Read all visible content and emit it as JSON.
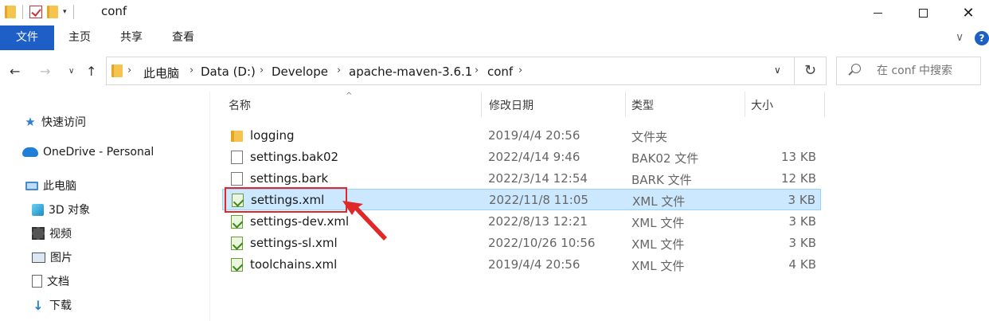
{
  "window": {
    "title": "conf",
    "controls": {
      "minimize": "—",
      "maximize": "☐",
      "close": "✕"
    }
  },
  "quick_access_toolbar": {
    "dropdown_glyph": "▾"
  },
  "ribbon": {
    "tabs": [
      "文件",
      "主页",
      "共享",
      "查看"
    ],
    "expand_glyph": "∨",
    "help_glyph": "?"
  },
  "navigation": {
    "back": "←",
    "forward": "→",
    "recent": "∨",
    "up": "↑",
    "refresh": "↻",
    "breadcrumb": [
      "此电脑",
      "Data (D:)",
      "Develope",
      "apache-maven-3.6.1",
      "conf"
    ],
    "separator": "›",
    "dropdown": "∨"
  },
  "search": {
    "placeholder": "在 conf 中搜索"
  },
  "nav_pane": {
    "items": [
      {
        "label": "快速访问",
        "icon": "star-icon"
      },
      {
        "label": "OneDrive - Personal",
        "icon": "cloud-icon"
      },
      {
        "label": "此电脑",
        "icon": "computer-icon"
      },
      {
        "label": "3D 对象",
        "icon": "cube-icon"
      },
      {
        "label": "视频",
        "icon": "video-icon"
      },
      {
        "label": "图片",
        "icon": "picture-icon"
      },
      {
        "label": "文档",
        "icon": "document-icon"
      },
      {
        "label": "下载",
        "icon": "download-icon"
      }
    ]
  },
  "file_list": {
    "columns": [
      "名称",
      "修改日期",
      "类型",
      "大小"
    ],
    "sort_indicator": "^",
    "rows": [
      {
        "name": "logging",
        "date": "2019/4/4 20:56",
        "type": "文件夹",
        "size": "",
        "icon": "folder-icon"
      },
      {
        "name": "settings.bak02",
        "date": "2022/4/14 9:46",
        "type": "BAK02 文件",
        "size": "13 KB",
        "icon": "file-icon"
      },
      {
        "name": "settings.bark",
        "date": "2022/3/14 12:54",
        "type": "BARK 文件",
        "size": "12 KB",
        "icon": "file-icon"
      },
      {
        "name": "settings.xml",
        "date": "2022/11/8 11:05",
        "type": "XML 文件",
        "size": "3 KB",
        "icon": "xml-file-icon",
        "selected": true
      },
      {
        "name": "settings-dev.xml",
        "date": "2022/8/13 12:21",
        "type": "XML 文件",
        "size": "3 KB",
        "icon": "xml-file-icon"
      },
      {
        "name": "settings-sl.xml",
        "date": "2022/10/26 10:56",
        "type": "XML 文件",
        "size": "3 KB",
        "icon": "xml-file-icon"
      },
      {
        "name": "toolchains.xml",
        "date": "2019/4/4 20:56",
        "type": "XML 文件",
        "size": "4 KB",
        "icon": "xml-file-icon"
      }
    ]
  },
  "annotation": {
    "color": "#e02828"
  }
}
